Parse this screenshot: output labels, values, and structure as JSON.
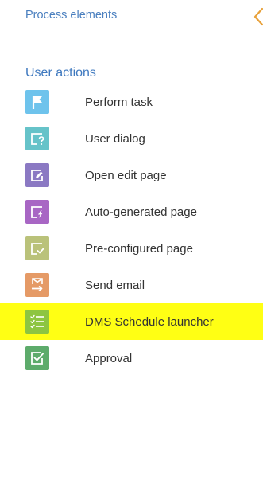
{
  "panel": {
    "title": "Process elements",
    "collapse_icon": "chevron-left-icon",
    "accent_color": "#e8a13a"
  },
  "group": {
    "label": "User actions"
  },
  "items": [
    {
      "label": "Perform task",
      "icon": "flag-icon",
      "color": "#6ec3ec",
      "highlighted": false
    },
    {
      "label": "User dialog",
      "icon": "dialog-question-icon",
      "color": "#66c3c9",
      "highlighted": false
    },
    {
      "label": "Open edit page",
      "icon": "edit-page-icon",
      "color": "#8b79c3",
      "highlighted": false
    },
    {
      "label": "Auto-generated page",
      "icon": "auto-page-icon",
      "color": "#a866c4",
      "highlighted": false
    },
    {
      "label": "Pre-configured page",
      "icon": "preconfigured-page-icon",
      "color": "#bac27a",
      "highlighted": false
    },
    {
      "label": "Send email",
      "icon": "send-email-icon",
      "color": "#e59a66",
      "highlighted": false
    },
    {
      "label": "DMS Schedule launcher",
      "icon": "checklist-icon",
      "color": "#8dc541",
      "highlighted": true,
      "highlight_color": "#ffff14"
    },
    {
      "label": "Approval",
      "icon": "approval-icon",
      "color": "#5dab6b",
      "highlighted": false
    }
  ]
}
